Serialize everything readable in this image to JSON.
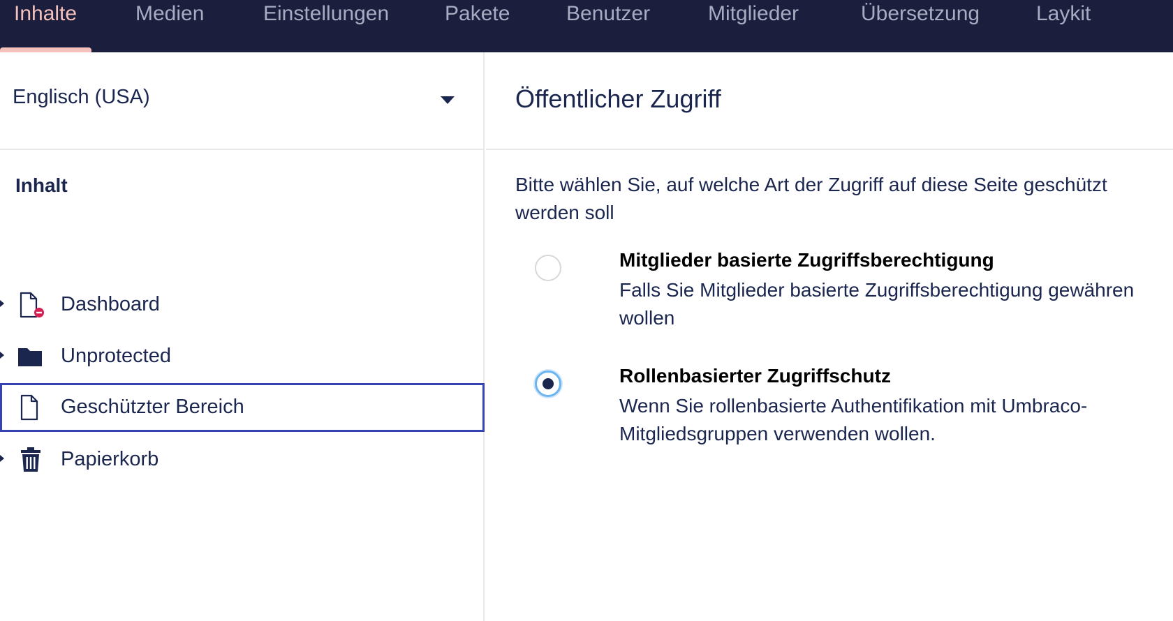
{
  "nav": {
    "items": [
      {
        "label": "Inhalte",
        "active": true
      },
      {
        "label": "Medien"
      },
      {
        "label": "Einstellungen"
      },
      {
        "label": "Pakete"
      },
      {
        "label": "Benutzer"
      },
      {
        "label": "Mitglieder"
      },
      {
        "label": "Übersetzung"
      },
      {
        "label": "Laykit"
      }
    ],
    "colors": {
      "background": "#1b1f3d",
      "active": "#f5c1bc",
      "inactive": "#a7acc3"
    }
  },
  "sidebar": {
    "language": "Englisch (USA)",
    "section_title": "Inhalt",
    "items": [
      {
        "label": "Dashboard",
        "icon": "document-restricted-icon",
        "expandable": true
      },
      {
        "label": "Unprotected",
        "icon": "folder-icon",
        "expandable": true
      },
      {
        "label": "Geschützter Bereich",
        "icon": "document-icon",
        "expandable": false,
        "selected": true
      },
      {
        "label": "Papierkorb",
        "icon": "trash-icon",
        "expandable": true
      }
    ]
  },
  "main": {
    "title": "Öffentlicher Zugriff",
    "intro": "Bitte wählen Sie, auf welche Art der Zugriff auf diese Seite geschützt werden soll",
    "options": [
      {
        "title": "Mitglieder basierte Zugriffsberechtigung",
        "description": "Falls Sie Mitglieder basierte Zugriffsberechtigung gewähren wollen",
        "selected": false
      },
      {
        "title": "Rollenbasierter Zugriffschutz",
        "description": "Wenn Sie rollenbasierte Authentifikation mit Umbraco-Mitgliedsgruppen verwenden wollen.",
        "selected": true
      }
    ]
  },
  "colors": {
    "text": "#1b264f",
    "selection_border": "#3544b1",
    "radio_focus": "#6ab4f0",
    "restricted_badge": "#d42054"
  }
}
